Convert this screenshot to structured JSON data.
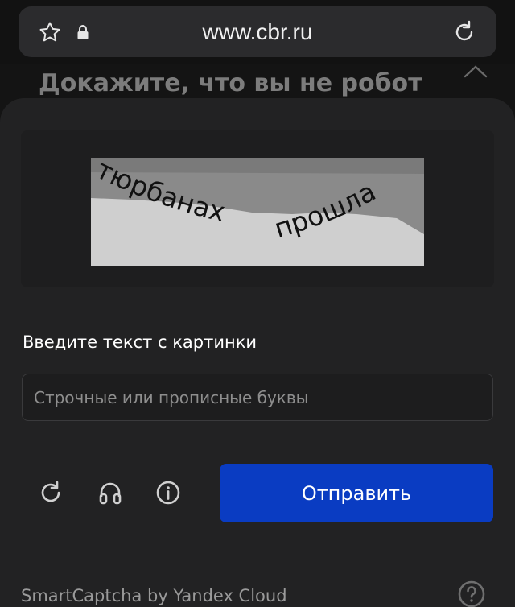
{
  "browser": {
    "url": "www.cbr.ru",
    "icons": [
      "star-icon",
      "lock-icon",
      "reload-icon"
    ]
  },
  "page": {
    "heading": "Докажите, что вы не робот"
  },
  "captcha": {
    "image_text_words": [
      "тюрбанах",
      "прошла"
    ],
    "prompt": "Введите текст с картинки",
    "input": {
      "value": "",
      "placeholder": "Строчные или прописные буквы"
    },
    "controls": [
      "refresh-icon",
      "audio-icon",
      "info-icon"
    ],
    "submit_label": "Отправить",
    "brand": "SmartCaptcha by Yandex Cloud",
    "help_icon": "question-circle-icon"
  },
  "colors": {
    "page_background": "#141414",
    "sheet_background": "#222223",
    "submit_button": "#0a3cc2",
    "input_border": "#3a3a3c"
  }
}
